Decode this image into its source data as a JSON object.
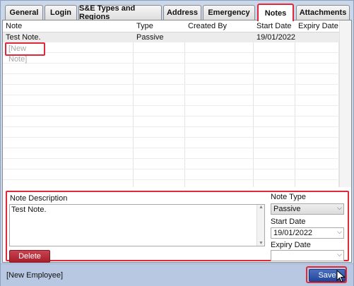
{
  "tabs": [
    {
      "label": "General",
      "active": false
    },
    {
      "label": "Login",
      "active": false
    },
    {
      "label": "S&E Types and Regions",
      "active": false
    },
    {
      "label": "Address",
      "active": false
    },
    {
      "label": "Emergency",
      "active": false
    },
    {
      "label": "Notes",
      "active": true
    },
    {
      "label": "Attachments",
      "active": false
    }
  ],
  "grid": {
    "columns": [
      "Note",
      "Type",
      "Created By",
      "Start Date",
      "Expiry Date"
    ],
    "rows": [
      {
        "note": "Test Note.",
        "type": "Passive",
        "created_by": "",
        "start_date": "19/01/2022",
        "expiry_date": ""
      }
    ],
    "new_row_placeholder": "[New Note]"
  },
  "detail": {
    "description_label": "Note Description",
    "description_value": "Test Note.",
    "delete_label": "Delete",
    "note_type_label": "Note Type",
    "note_type_value": "Passive",
    "start_date_label": "Start Date",
    "start_date_value": "19/01/2022",
    "expiry_date_label": "Expiry Date",
    "expiry_date_value": ""
  },
  "footer": {
    "status_text": "[New Employee]",
    "save_label": "Save"
  },
  "colors": {
    "highlight": "#e0283a",
    "save_button": "#2f54a8",
    "delete_button": "#b5303c"
  }
}
